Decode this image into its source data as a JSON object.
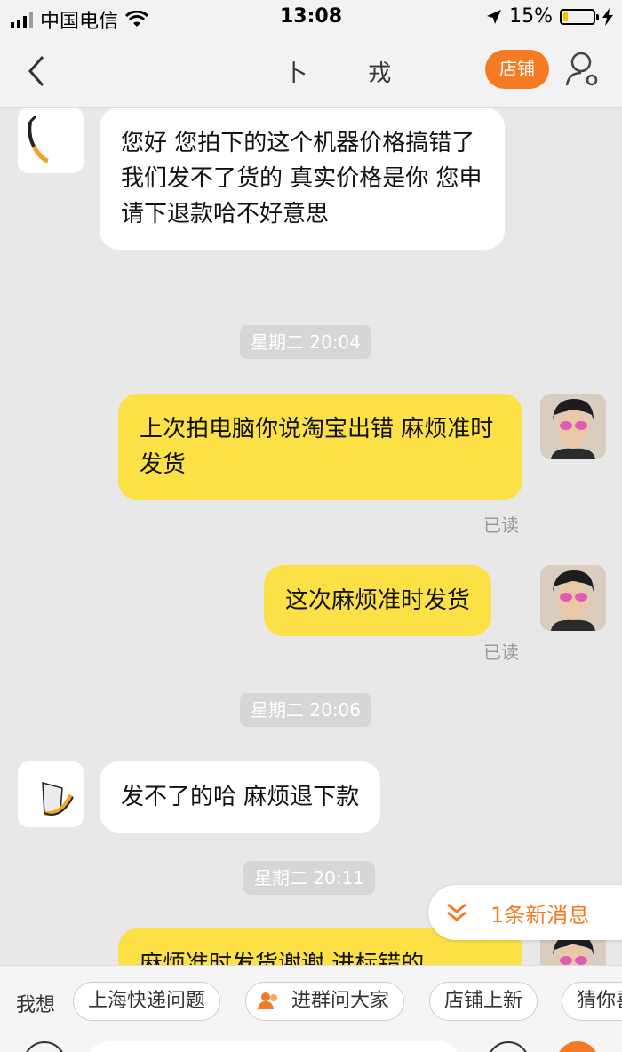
{
  "status_bar": {
    "carrier": "中国电信",
    "time": "13:08",
    "battery_percent": "15%",
    "battery_level": 0.15
  },
  "nav": {
    "title": "卜 戎",
    "shop_button": "店铺"
  },
  "messages": [
    {
      "type": "in",
      "text": "您好 您拍下的这个机器价格搞错了 我们发不了货的 真实价格是你 您申请下退款哈不好意思"
    },
    {
      "type": "timestamp",
      "text": "星期二 20:04"
    },
    {
      "type": "out",
      "text": "上次拍电脑你说淘宝出错 麻烦准时发货",
      "read": "已读"
    },
    {
      "type": "out",
      "text": "这次麻烦准时发货",
      "read": "已读"
    },
    {
      "type": "timestamp",
      "text": "星期二 20:06"
    },
    {
      "type": "in",
      "text": "发不了的哈 麻烦退下款"
    },
    {
      "type": "timestamp",
      "text": "星期二 20:11"
    },
    {
      "type": "out",
      "text": "麻烦准时发货谢谢 进标错的"
    }
  ],
  "new_message_tip": "1条新消息",
  "quick_bar": {
    "label": "我想",
    "chips": [
      "上海快递问题",
      "进群问大家",
      "店铺上新",
      "猜你喜"
    ]
  },
  "colors": {
    "accent": "#f47b24",
    "out_bubble": "#fbe046",
    "in_bubble": "#ffffff",
    "background": "#e8e8e8"
  }
}
